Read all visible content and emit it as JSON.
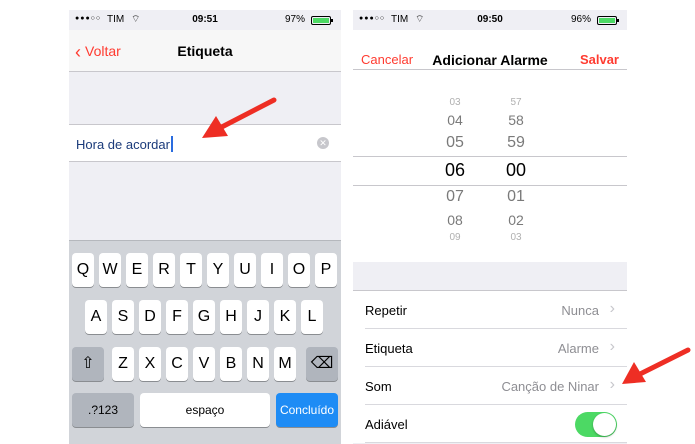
{
  "left_screen": {
    "status": {
      "signal": "●●●○○",
      "carrier": "TIM",
      "time": "09:51",
      "battery": "97%"
    },
    "nav": {
      "back": "Voltar",
      "title": "Etiqueta"
    },
    "label_field": {
      "value": "Hora de acordar"
    },
    "keyboard": {
      "row1": [
        "Q",
        "W",
        "E",
        "R",
        "T",
        "Y",
        "U",
        "I",
        "O",
        "P"
      ],
      "row2": [
        "A",
        "S",
        "D",
        "F",
        "G",
        "H",
        "J",
        "K",
        "L"
      ],
      "row3": [
        "Z",
        "X",
        "C",
        "V",
        "B",
        "N",
        "M"
      ],
      "numbers_key": ".?123",
      "space_key": "espaço",
      "done_key": "Concluído",
      "shift_icon": "⇧",
      "delete_icon": "⌫"
    }
  },
  "right_screen": {
    "status": {
      "signal": "●●●○○",
      "carrier": "TIM",
      "time": "09:50",
      "battery": "96%"
    },
    "nav": {
      "cancel": "Cancelar",
      "title": "Adicionar Alarme",
      "save": "Salvar"
    },
    "picker": {
      "hours": [
        "03",
        "04",
        "05",
        "06",
        "07",
        "08",
        "09"
      ],
      "minutes": [
        "57",
        "58",
        "59",
        "00",
        "01",
        "02",
        "03"
      ],
      "selected_hour": "06",
      "selected_minute": "00"
    },
    "settings": [
      {
        "label": "Repetir",
        "value": "Nunca"
      },
      {
        "label": "Etiqueta",
        "value": "Alarme"
      },
      {
        "label": "Som",
        "value": "Canção de Ninar"
      },
      {
        "label": "Adiável",
        "value": ""
      }
    ],
    "snooze_on": true
  },
  "colors": {
    "accent": "#ff3b30",
    "toggle": "#4cd964",
    "done": "#1e8cf5",
    "annotation_arrow": "#ee2e24"
  }
}
